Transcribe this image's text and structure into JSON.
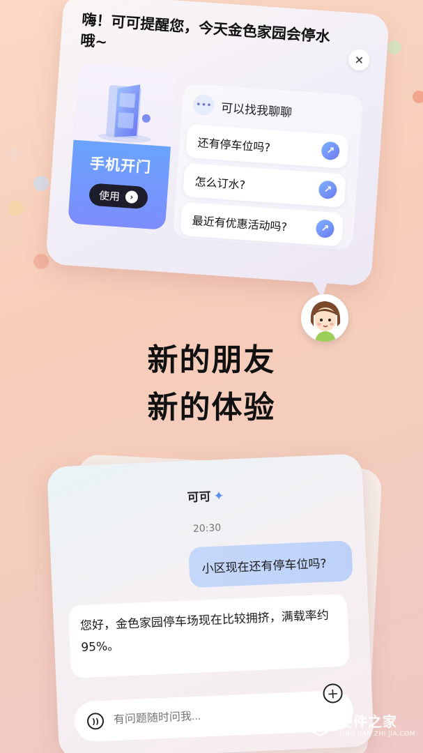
{
  "top_card": {
    "title": "嗨！可可提醒您，今天金色家园会停水哦~",
    "close_icon": "close-icon",
    "door_tile": {
      "label": "手机开门",
      "button_label": "使用",
      "button_icon": "chevron-right-icon"
    },
    "chat_panel": {
      "header": "可以找我聊聊",
      "header_icon": "chat-bubble-icon",
      "questions": [
        {
          "text": "还有停车位吗?",
          "icon": "arrow-up-right-icon"
        },
        {
          "text": "怎么订水?",
          "icon": "arrow-up-right-icon"
        },
        {
          "text": "最近有优惠活动吗?",
          "icon": "arrow-up-right-icon"
        }
      ]
    }
  },
  "headline": {
    "line1": "新的朋友",
    "line2": "新的体验"
  },
  "chat_card": {
    "title": "可可",
    "title_icon": "sparkle-icon",
    "time": "20:30",
    "user_message": "小区现在还有停车位吗?",
    "bot_message": "您好，金色家园停车场现在比较拥挤，满载率约95%。",
    "input_placeholder": "有问题随时问我...",
    "voice_icon": "voice-icon",
    "add_icon": "plus-icon"
  },
  "watermark": {
    "name": "硬件之家",
    "url": "YING JIAN ZHI JIA.COM"
  },
  "colors": {
    "background": "#f7cdb9",
    "accent_blue": "#6c7bf2",
    "door_blue": "#6aa3ff",
    "user_bubble": "#c5d8fb"
  }
}
